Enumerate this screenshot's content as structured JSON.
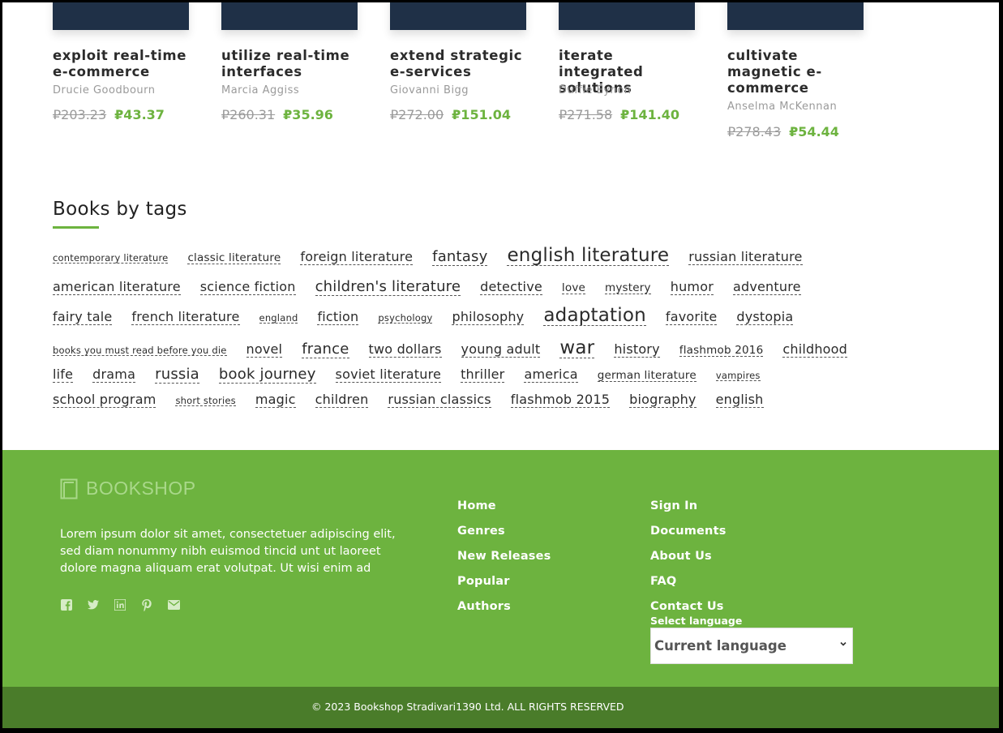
{
  "books": [
    {
      "title": "exploit real-time e-commerce",
      "author": "Drucie Goodbourn",
      "old_price": "₽203.23",
      "new_price": "₽43.37"
    },
    {
      "title": "utilize real-time interfaces",
      "author": "Marcia Aggiss",
      "old_price": "₽260.31",
      "new_price": "₽35.96"
    },
    {
      "title": "extend strategic e-services",
      "author": "Giovanni Bigg",
      "old_price": "₽272.00",
      "new_price": "₽151.04"
    },
    {
      "title": "iterate integrated solutions",
      "author": "Duffie Eynon",
      "old_price": "₽271.58",
      "new_price": "₽141.40"
    },
    {
      "title": "cultivate magnetic e-commerce",
      "author": "Anselma McKennan",
      "old_price": "₽278.43",
      "new_price": "₽54.44"
    }
  ],
  "tags_heading": "Books by tags",
  "tag_rows": [
    [
      "contemporary literature",
      "classic literature",
      "foreign literature",
      "fantasy",
      "english literature",
      "russian literature"
    ],
    [
      "american literature",
      "science fiction",
      "children's literature",
      "detective",
      "love",
      "mystery",
      "humor",
      "adventure"
    ],
    [
      "fairy tale",
      "french literature",
      "england",
      "fiction",
      "psychology",
      "philosophy",
      "adaptation",
      "favorite",
      "dystopia"
    ],
    [
      "books you must read before you die",
      "novel",
      "france",
      "two dollars",
      "young adult",
      "war",
      "history",
      "flashmob 2016",
      "childhood"
    ],
    [
      "life",
      "drama",
      "russia",
      "book journey",
      "soviet literature",
      "thriller",
      "america",
      "german literature",
      "vampires"
    ],
    [
      "school program",
      "short stories",
      "magic",
      "children",
      "russian classics",
      "flashmob 2015",
      "biography",
      "english"
    ]
  ],
  "footer": {
    "logo_text": "BOOKSHOP",
    "description": "Lorem ipsum dolor sit amet, consectetuer adipiscing elit, sed diam nonummy nibh euismod tincid unt ut laoreet dolore magna aliquam erat volutpat. Ut wisi enim ad",
    "social_icons": [
      "facebook-icon",
      "twitter-icon",
      "linkedin-icon",
      "pinterest-icon",
      "email-icon"
    ],
    "links_col1": [
      "Home",
      "Genres",
      "New Releases",
      "Popular",
      "Authors"
    ],
    "links_col2": [
      "Sign In",
      "Documents",
      "About Us",
      "FAQ",
      "Contact Us"
    ],
    "language_label": "Select language",
    "language_value": "Current language",
    "copyright": "© 2023 Bookshop Stradivari1390 Ltd. ALL RIGHTS RESERVED"
  },
  "colors": {
    "accent": "#6db33f",
    "footer_bottom": "#4a7c2a"
  }
}
